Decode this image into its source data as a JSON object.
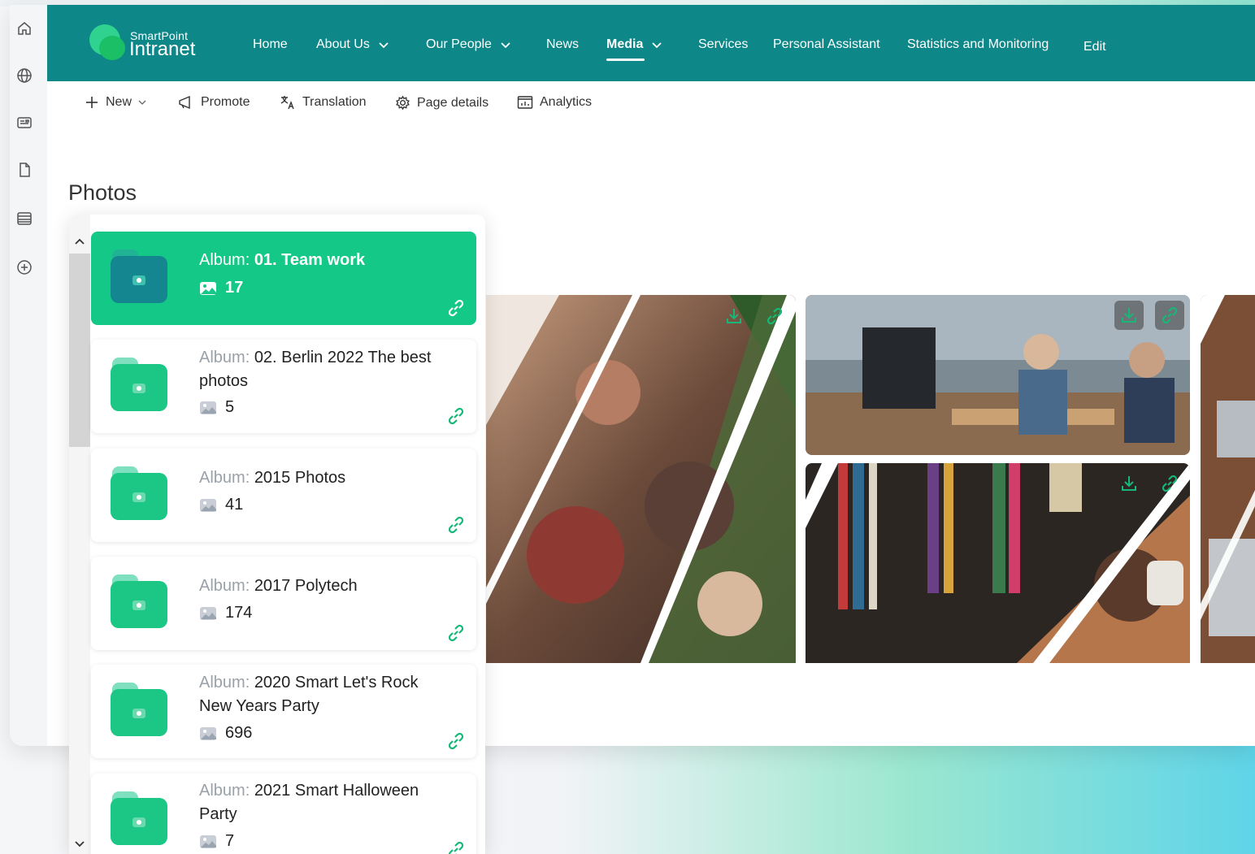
{
  "brand": {
    "small": "SmartPoint",
    "big": "Intranet"
  },
  "nav": {
    "home": "Home",
    "about": "About Us",
    "people": "Our People",
    "news": "News",
    "media": "Media",
    "services": "Services",
    "assistant": "Personal Assistant",
    "stats": "Statistics and Monitoring",
    "edit": "Edit"
  },
  "commands": {
    "new": "New",
    "promote": "Promote",
    "translation": "Translation",
    "page_details": "Page details",
    "analytics": "Analytics"
  },
  "section_title": "Photos",
  "album_prefix": "Album:",
  "albums": [
    {
      "name": "01. Team work",
      "count": "17",
      "active": true
    },
    {
      "name": "02. Berlin 2022 The best photos",
      "count": "5",
      "active": false
    },
    {
      "name": "2015 Photos",
      "count": "41",
      "active": false
    },
    {
      "name": "2017 Polytech",
      "count": "174",
      "active": false
    },
    {
      "name": "2020 Smart Let's Rock New Years Party",
      "count": "696",
      "active": false
    },
    {
      "name": "2021 Smart Halloween Party",
      "count": "7",
      "active": false
    }
  ],
  "colors": {
    "header": "#0e8788",
    "accent_green": "#14c888",
    "link_green": "#16b877"
  },
  "icons": {
    "rail": [
      "home-icon",
      "globe-icon",
      "news-icon",
      "document-icon",
      "list-icon",
      "add-circle-icon"
    ],
    "gallery_actions": [
      "download-icon",
      "link-icon"
    ]
  }
}
